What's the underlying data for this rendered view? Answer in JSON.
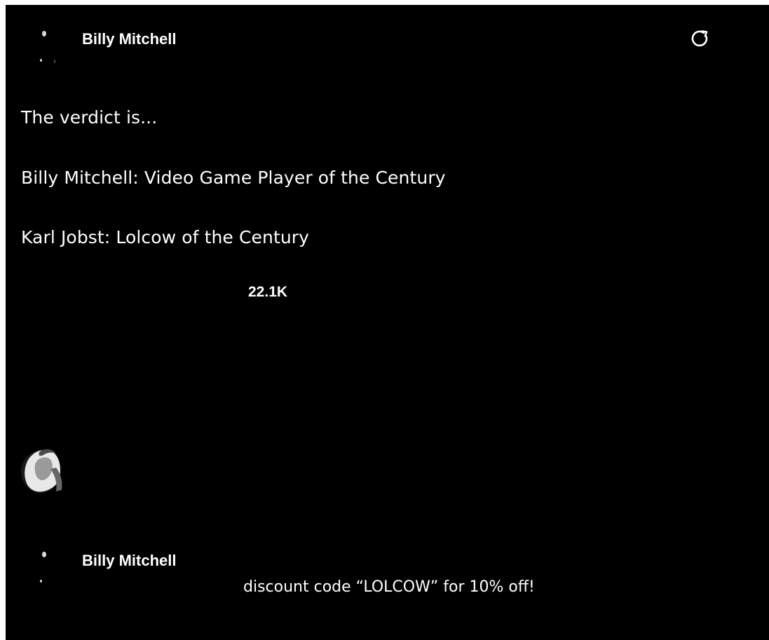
{
  "post": {
    "author": "Billy Mitchell",
    "lines": [
      "The verdict is...",
      "Billy Mitchell: Video Game Player of the Century",
      "Karl Jobst: Lolcow of the Century"
    ],
    "count": "22.1K"
  },
  "second_post": {
    "author": "Billy Mitchell",
    "text": "discount code “LOLCOW” for 10% off!"
  },
  "icons": {
    "refresh": "refresh-icon",
    "avatar": "avatar-icon"
  },
  "colors": {
    "background": "#000000",
    "text": "#ffffff"
  }
}
